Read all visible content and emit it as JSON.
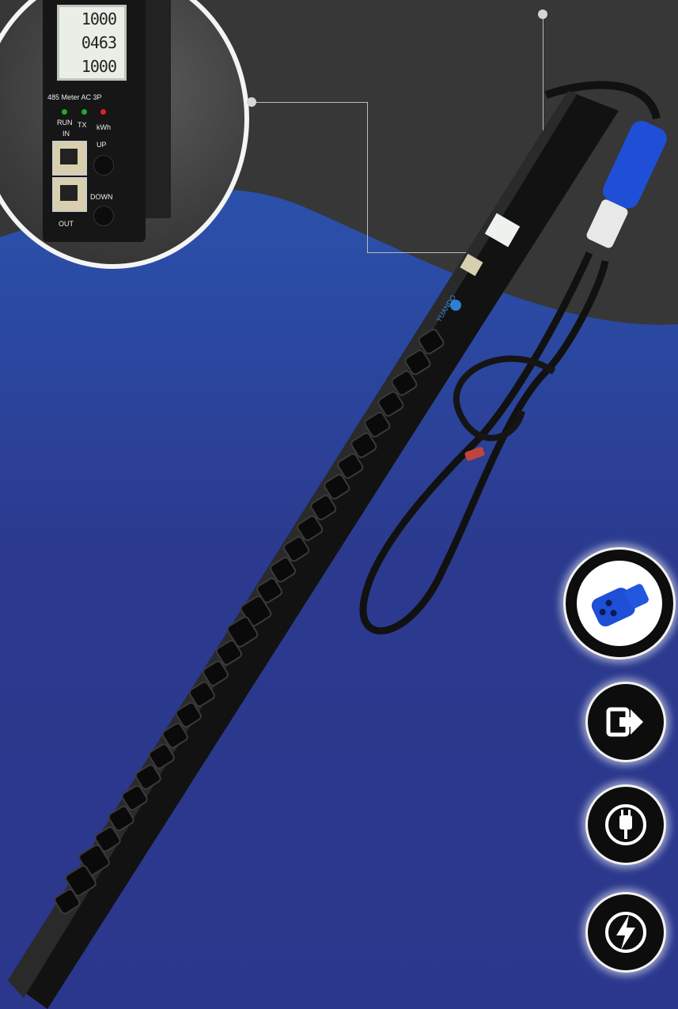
{
  "colors": {
    "background_top": "#2a5db8",
    "background_bottom": "#2b378c",
    "dark_panel": "#3a3a3a",
    "plug_blue": "#1e4fd6"
  },
  "meter": {
    "lcd_lines": [
      "1000",
      "0463",
      "1000"
    ],
    "model_label": "485 Meter AC 3P",
    "led_labels": [
      "RUN",
      "TX",
      "kWh"
    ],
    "port_labels": [
      "IN",
      "OUT"
    ],
    "button_labels": [
      "UP",
      "DOWN"
    ]
  },
  "pdu": {
    "brand": "YUANDO",
    "outlet_count": 28
  },
  "icons": [
    "blue-industrial-plug-icon",
    "output-arrow-icon",
    "power-plug-icon",
    "lightning-bolt-icon"
  ]
}
